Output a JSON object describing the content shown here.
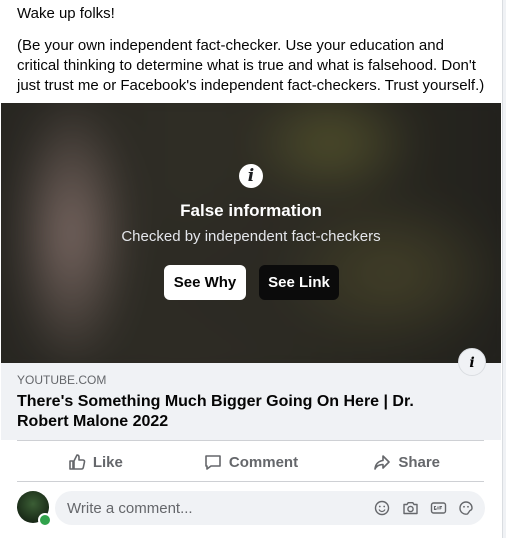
{
  "post": {
    "paragraph1": "Wake up folks!",
    "paragraph2": "(Be your own independent fact-checker. Use your education and critical thinking to determine what is true and what is falsehood. Don't just trust me or Facebook's independent fact-checkers. Trust yourself.)"
  },
  "fact_check": {
    "title": "False information",
    "subtitle": "Checked by independent fact-checkers",
    "see_why": "See Why",
    "see_link": "See Link",
    "icon": "info-icon",
    "icon_glyph": "i"
  },
  "link_preview": {
    "domain": "YOUTUBE.COM",
    "title": "There's Something Much Bigger Going On Here | Dr. Robert Malone 2022"
  },
  "actions": {
    "like": "Like",
    "comment": "Comment",
    "share": "Share"
  },
  "comment_box": {
    "placeholder": "Write a comment...",
    "icons": [
      "emoji-icon",
      "camera-icon",
      "gif-icon",
      "sticker-icon"
    ]
  },
  "colors": {
    "secondary_text": "#65676b",
    "online": "#31a24c",
    "surface": "#f0f2f5"
  }
}
